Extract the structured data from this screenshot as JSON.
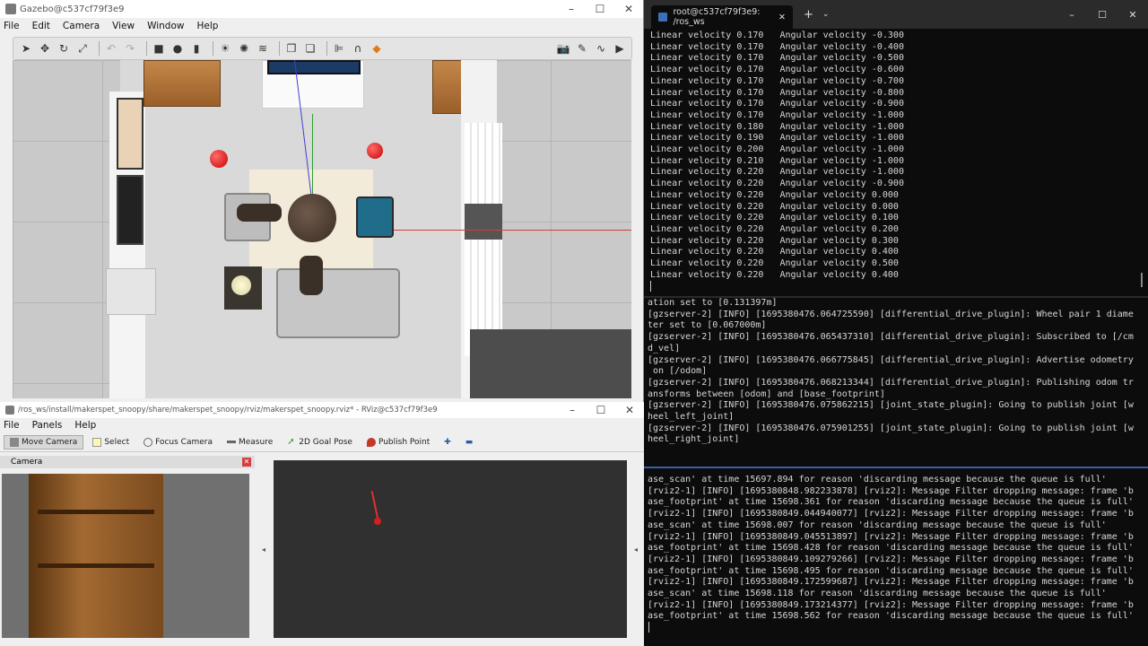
{
  "gazebo": {
    "title": "Gazebo@c537cf79f3e9",
    "menu": [
      "File",
      "Edit",
      "Camera",
      "View",
      "Window",
      "Help"
    ]
  },
  "rviz": {
    "title": "/ros_ws/install/makerspet_snoopy/share/makerspet_snoopy/rviz/makerspet_snoopy.rviz* - RViz@c537cf79f3e9",
    "menu": [
      "File",
      "Panels",
      "Help"
    ],
    "tools": [
      "Move Camera",
      "Select",
      "Focus Camera",
      "Measure",
      "2D Goal Pose",
      "Publish Point"
    ],
    "camera_panel_title": "Camera"
  },
  "terminal": {
    "tab_title": "root@c537cf79f3e9: /ros_ws",
    "pane1_lines": [
      "Linear velocity 0.170   Angular velocity -0.300",
      "Linear velocity 0.170   Angular velocity -0.400",
      "Linear velocity 0.170   Angular velocity -0.500",
      "Linear velocity 0.170   Angular velocity -0.600",
      "Linear velocity 0.170   Angular velocity -0.700",
      "Linear velocity 0.170   Angular velocity -0.800",
      "Linear velocity 0.170   Angular velocity -0.900",
      "Linear velocity 0.170   Angular velocity -1.000",
      "Linear velocity 0.180   Angular velocity -1.000",
      "Linear velocity 0.190   Angular velocity -1.000",
      "Linear velocity 0.200   Angular velocity -1.000",
      "Linear velocity 0.210   Angular velocity -1.000",
      "Linear velocity 0.220   Angular velocity -1.000",
      "Linear velocity 0.220   Angular velocity -0.900",
      "Linear velocity 0.220   Angular velocity 0.000",
      "Linear velocity 0.220   Angular velocity 0.000",
      "Linear velocity 0.220   Angular velocity 0.100",
      "Linear velocity 0.220   Angular velocity 0.200",
      "Linear velocity 0.220   Angular velocity 0.300",
      "Linear velocity 0.220   Angular velocity 0.400",
      "Linear velocity 0.220   Angular velocity 0.500",
      "Linear velocity 0.220   Angular velocity 0.400"
    ],
    "pane2_lines": [
      "ation set to [0.131397m]",
      "[gzserver-2] [INFO] [1695380476.064725590] [differential_drive_plugin]: Wheel pair 1 diame",
      "ter set to [0.067000m]",
      "[gzserver-2] [INFO] [1695380476.065437310] [differential_drive_plugin]: Subscribed to [/cm",
      "d_vel]",
      "[gzserver-2] [INFO] [1695380476.066775845] [differential_drive_plugin]: Advertise odometry",
      " on [/odom]",
      "[gzserver-2] [INFO] [1695380476.068213344] [differential_drive_plugin]: Publishing odom tr",
      "ansforms between [odom] and [base_footprint]",
      "[gzserver-2] [INFO] [1695380476.075862215] [joint_state_plugin]: Going to publish joint [w",
      "heel_left_joint]",
      "[gzserver-2] [INFO] [1695380476.075901255] [joint_state_plugin]: Going to publish joint [w",
      "heel_right_joint]"
    ],
    "pane3_lines": [
      "ase_scan' at time 15697.894 for reason 'discarding message because the queue is full'",
      "[rviz2-1] [INFO] [1695380848.982233878] [rviz2]: Message Filter dropping message: frame 'b",
      "ase_footprint' at time 15698.361 for reason 'discarding message because the queue is full'",
      "[rviz2-1] [INFO] [1695380849.044940077] [rviz2]: Message Filter dropping message: frame 'b",
      "ase_scan' at time 15698.007 for reason 'discarding message because the queue is full'",
      "[rviz2-1] [INFO] [1695380849.045513897] [rviz2]: Message Filter dropping message: frame 'b",
      "ase_footprint' at time 15698.428 for reason 'discarding message because the queue is full'",
      "[rviz2-1] [INFO] [1695380849.109279266] [rviz2]: Message Filter dropping message: frame 'b",
      "ase_footprint' at time 15698.495 for reason 'discarding message because the queue is full'",
      "[rviz2-1] [INFO] [1695380849.172599687] [rviz2]: Message Filter dropping message: frame 'b",
      "ase_scan' at time 15698.118 for reason 'discarding message because the queue is full'",
      "[rviz2-1] [INFO] [1695380849.173214377] [rviz2]: Message Filter dropping message: frame 'b",
      "ase_footprint' at time 15698.562 for reason 'discarding message because the queue is full'"
    ]
  }
}
